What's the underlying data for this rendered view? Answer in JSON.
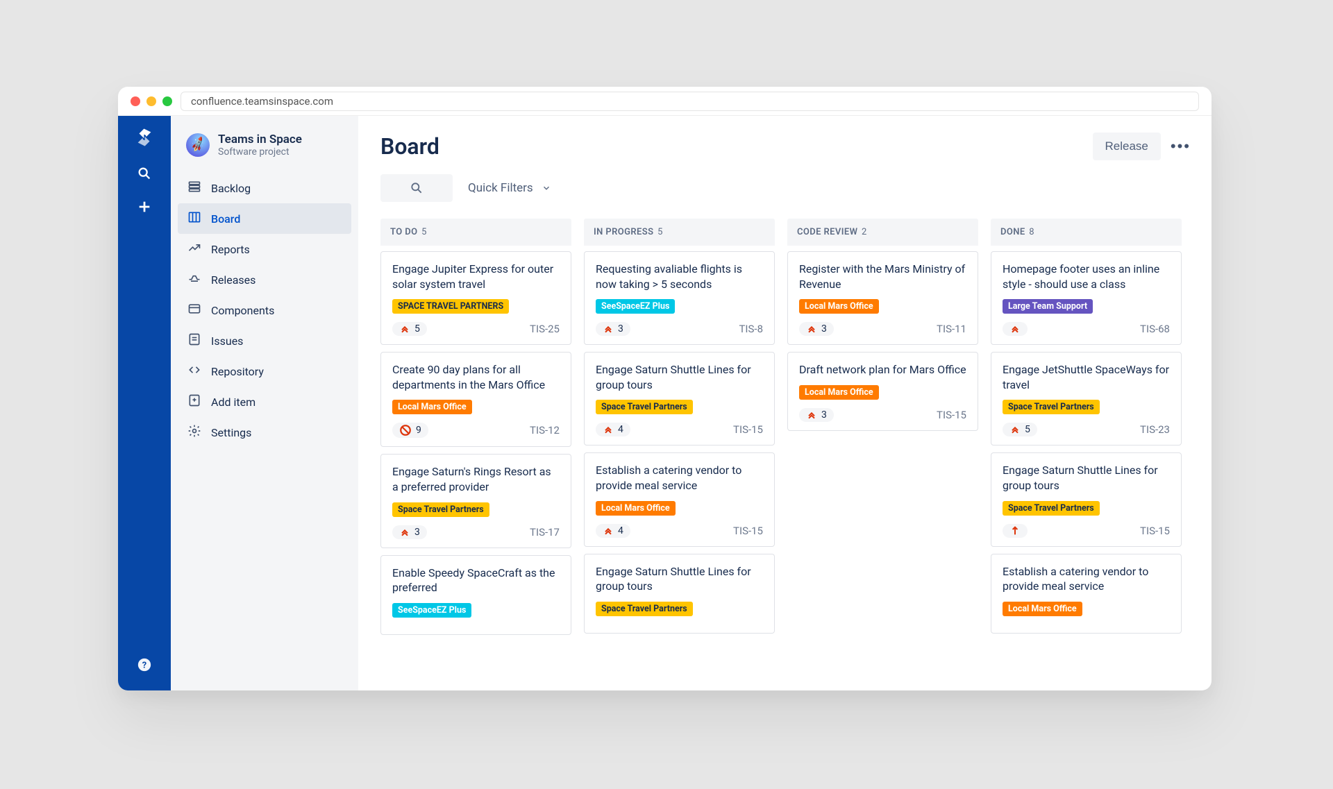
{
  "url": "confluence.teamsinspace.com",
  "project": {
    "name": "Teams in Space",
    "subtitle": "Software project"
  },
  "sidebar": {
    "items": [
      {
        "label": "Backlog",
        "icon": "backlog"
      },
      {
        "label": "Board",
        "icon": "board",
        "active": true
      },
      {
        "label": "Reports",
        "icon": "reports"
      },
      {
        "label": "Releases",
        "icon": "releases"
      },
      {
        "label": "Components",
        "icon": "components"
      },
      {
        "label": "Issues",
        "icon": "issues"
      },
      {
        "label": "Repository",
        "icon": "repo"
      },
      {
        "label": "Add item",
        "icon": "add"
      },
      {
        "label": "Settings",
        "icon": "settings"
      }
    ]
  },
  "page": {
    "title": "Board",
    "release": "Release",
    "quickfilters": "Quick Filters"
  },
  "columns": [
    {
      "name": "TO DO",
      "count": 5,
      "cards": [
        {
          "title": "Engage Jupiter Express for outer solar system travel",
          "tag": "SPACE TRAVEL PARTNERS",
          "tagColor": "yellow",
          "points": 5,
          "key": "TIS-25",
          "prio": "highest"
        },
        {
          "title": "Create 90 day plans for all departments in the Mars Office",
          "tag": "Local Mars Office",
          "tagColor": "orange",
          "points": 9,
          "key": "TIS-12",
          "prio": "blocker"
        },
        {
          "title": "Engage Saturn's Rings Resort as a preferred provider",
          "tag": "Space Travel Partners",
          "tagColor": "yellow",
          "points": 3,
          "key": "TIS-17",
          "prio": "highest"
        },
        {
          "title": "Enable Speedy SpaceCraft as the preferred",
          "tag": "SeeSpaceEZ Plus",
          "tagColor": "teal",
          "points": "",
          "key": "",
          "prio": ""
        }
      ]
    },
    {
      "name": "IN PROGRESS",
      "count": 5,
      "cards": [
        {
          "title": "Requesting avaliable flights is now taking > 5 seconds",
          "tag": "SeeSpaceEZ Plus",
          "tagColor": "teal",
          "points": 3,
          "key": "TIS-8",
          "prio": "highest"
        },
        {
          "title": "Engage Saturn Shuttle Lines for group tours",
          "tag": "Space Travel Partners",
          "tagColor": "yellow",
          "points": 4,
          "key": "TIS-15",
          "prio": "highest"
        },
        {
          "title": "Establish a catering vendor to provide meal service",
          "tag": "Local Mars Office",
          "tagColor": "orange",
          "points": 4,
          "key": "TIS-15",
          "prio": "highest"
        },
        {
          "title": "Engage Saturn Shuttle Lines for group tours",
          "tag": "Space Travel Partners",
          "tagColor": "yellow",
          "points": "",
          "key": "",
          "prio": ""
        }
      ]
    },
    {
      "name": "CODE REVIEW",
      "count": 2,
      "cards": [
        {
          "title": "Register with the Mars Ministry of Revenue",
          "tag": "Local Mars Office",
          "tagColor": "orange",
          "points": 3,
          "key": "TIS-11",
          "prio": "highest"
        },
        {
          "title": "Draft network plan for Mars Office",
          "tag": "Local Mars Office",
          "tagColor": "orange",
          "points": 3,
          "key": "TIS-15",
          "prio": "highest"
        }
      ]
    },
    {
      "name": "DONE",
      "count": 8,
      "cards": [
        {
          "title": "Homepage footer uses an inline style - should use a class",
          "tag": "Large Team Support",
          "tagColor": "purple",
          "points": "",
          "key": "TIS-68",
          "prio": "highest"
        },
        {
          "title": "Engage JetShuttle SpaceWays for travel",
          "tag": "Space Travel Partners",
          "tagColor": "yellow",
          "points": 5,
          "key": "TIS-23",
          "prio": "highest"
        },
        {
          "title": "Engage Saturn Shuttle Lines for group tours",
          "tag": "Space Travel Partners",
          "tagColor": "yellow",
          "points": "",
          "key": "TIS-15",
          "prio": "medium"
        },
        {
          "title": "Establish a catering vendor to provide meal service",
          "tag": "Local Mars Office",
          "tagColor": "orange",
          "points": "",
          "key": "",
          "prio": ""
        }
      ]
    }
  ]
}
